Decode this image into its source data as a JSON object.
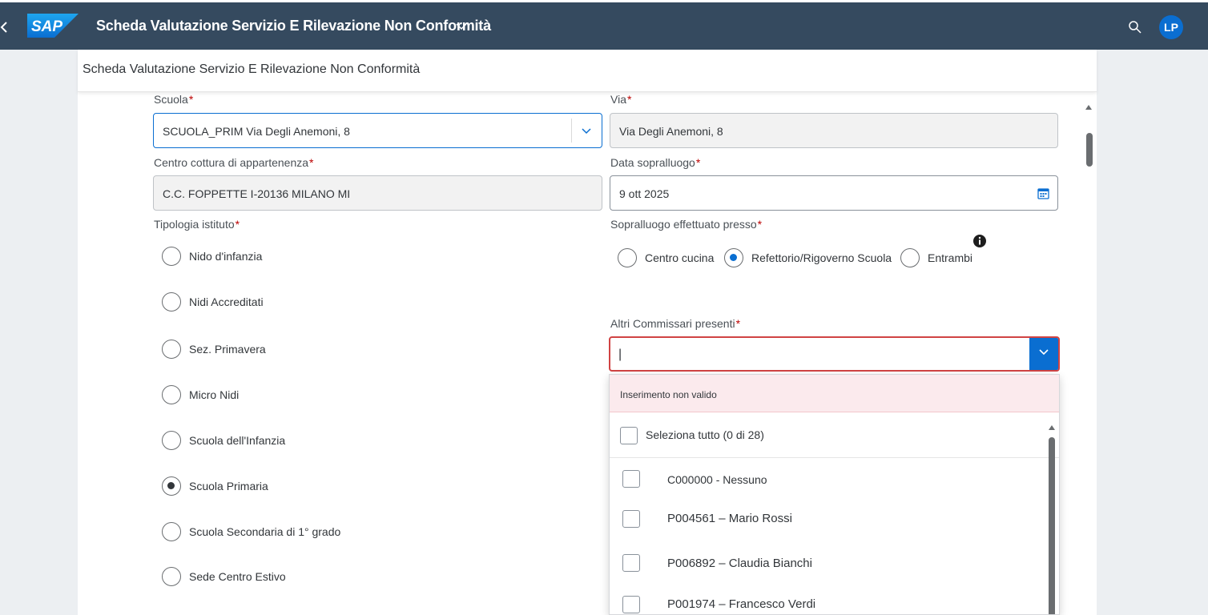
{
  "shell": {
    "logo_text": "SAP",
    "app_title": "Scheda Valutazione Servizio E Rilevazione Non Conformità",
    "avatar_initials": "LP",
    "colors": {
      "shellbar": "#354a5f",
      "accent": "#0a6ed1",
      "required": "#bb0000",
      "error": "#d04343"
    }
  },
  "page": {
    "title": "Scheda Valutazione Servizio E Rilevazione Non Conformità"
  },
  "form": {
    "scuola": {
      "label": "Scuola",
      "value": "SCUOLA_PRIM Via Degli Anemoni, 8"
    },
    "via": {
      "label": "Via",
      "value": "Via Degli Anemoni, 8"
    },
    "centro": {
      "label": "Centro cottura di appartenenza",
      "value": "C.C. FOPPETTE I-20136 MILANO MI"
    },
    "data": {
      "label": "Data sopralluogo",
      "value": "9 ott 2025"
    },
    "tipologia": {
      "label": "Tipologia istituto",
      "options": [
        {
          "label": "Nido d'infanzia",
          "selected": false
        },
        {
          "label": "Nidi Accreditati",
          "selected": false
        },
        {
          "label": "Sez. Primavera",
          "selected": false
        },
        {
          "label": "Micro Nidi",
          "selected": false
        },
        {
          "label": "Scuola dell'Infanzia",
          "selected": false
        },
        {
          "label": "Scuola Primaria",
          "selected": true
        },
        {
          "label": "Scuola Secondaria di 1° grado",
          "selected": false
        },
        {
          "label": "Sede Centro Estivo",
          "selected": false
        }
      ]
    },
    "sopralluogo": {
      "label": "Sopralluogo effettuato presso",
      "options": [
        {
          "label": "Centro cucina",
          "selected": false
        },
        {
          "label": "Refettorio/Rigoverno Scuola",
          "selected": true
        },
        {
          "label": "Entrambi",
          "selected": false
        }
      ],
      "info_icon": "info-icon"
    },
    "commissari": {
      "label": "Altri Commissari presenti",
      "value": "|",
      "error_message": "Inserimento non valido",
      "select_all": "Seleziona tutto (0 di 28)",
      "items": [
        {
          "label": "C000000 - Nessuno"
        },
        {
          "label": "P004561 – Mario Rossi"
        },
        {
          "label": "P006892 – Claudia Bianchi"
        },
        {
          "label": "P001974 – Francesco Verdi"
        }
      ]
    }
  },
  "required_marker": "*"
}
